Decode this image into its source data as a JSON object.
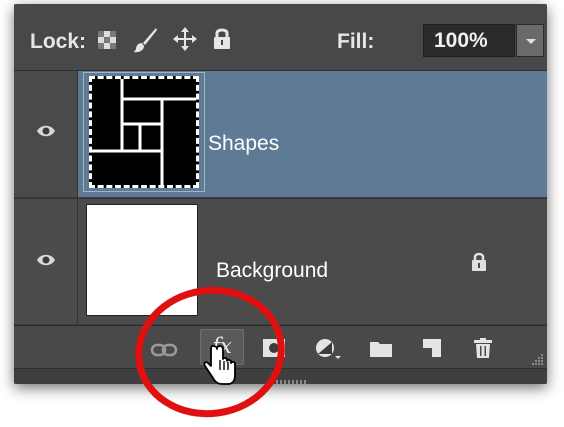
{
  "lockbar": {
    "lock_label": "Lock:",
    "lock_icons": [
      "transparent-pixels-lock-icon",
      "brush-lock-icon",
      "move-lock-icon",
      "padlock-icon"
    ],
    "fill_label": "Fill:",
    "fill_value": "100%"
  },
  "layers": [
    {
      "name": "Shapes",
      "selected": true,
      "visible": true,
      "thumbnail": "black-shapes"
    },
    {
      "name": "Background",
      "selected": false,
      "visible": true,
      "locked": true,
      "thumbnail": "white"
    }
  ],
  "footer": {
    "fx_label": "fx",
    "buttons": [
      "link-layers-icon",
      "fx-icon",
      "layer-mask-icon",
      "adjustment-layer-icon",
      "group-folder-icon",
      "new-layer-icon",
      "trash-icon"
    ]
  },
  "colors": {
    "selected_layer": "#5e7a95",
    "panel_bg": "#3c3c3c",
    "highlight_circle": "#e01010"
  }
}
